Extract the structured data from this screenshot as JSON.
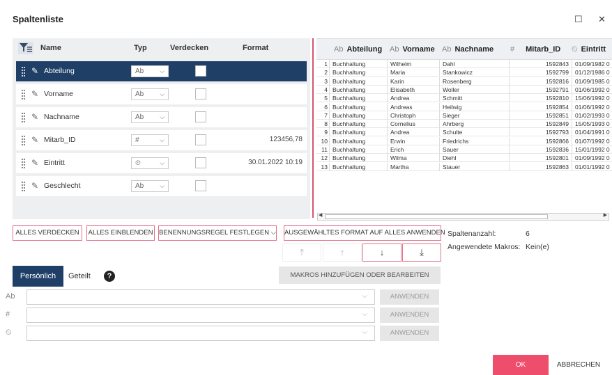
{
  "window": {
    "title": "Spaltenliste",
    "maximize": "☐",
    "close": "✕"
  },
  "columns_header": {
    "name": "Name",
    "typ": "Typ",
    "verdecken": "Verdecken",
    "format": "Format"
  },
  "column_rows": [
    {
      "name": "Abteilung",
      "typ": "Ab",
      "format": "",
      "selected": true
    },
    {
      "name": "Vorname",
      "typ": "Ab",
      "format": ""
    },
    {
      "name": "Nachname",
      "typ": "Ab",
      "format": ""
    },
    {
      "name": "Mitarb_ID",
      "typ": "#",
      "format": "123456,78"
    },
    {
      "name": "Eintritt",
      "typ": "⏲",
      "format": "30.01.2022 10:19"
    },
    {
      "name": "Geschlecht",
      "typ": "Ab",
      "format": ""
    }
  ],
  "data_header": {
    "abteilung": "Abteilung",
    "abteilung_icon": "Ab",
    "vorname": "Vorname",
    "vorname_icon": "Ab",
    "nachname": "Nachname",
    "nachname_icon": "Ab",
    "mitarb_id": "Mitarb_ID",
    "mitarb_icon": "#",
    "eintritt": "Eintritt",
    "eintritt_icon": "⏲"
  },
  "data_rows": [
    [
      "1",
      "Buchhaltung",
      "Wilhelm",
      "Dahl",
      "1592843",
      "01/09/1982 0"
    ],
    [
      "2",
      "Buchhaltung",
      "Maria",
      "Stankowicz",
      "1592799",
      "01/12/1986 0"
    ],
    [
      "3",
      "Buchhaltung",
      "Karin",
      "Rosenberg",
      "1592816",
      "01/09/1985 0"
    ],
    [
      "4",
      "Buchhaltung",
      "Elisabeth",
      "Woller",
      "1592791",
      "01/06/1992 0"
    ],
    [
      "5",
      "Buchhaltung",
      "Andrea",
      "Schmitt",
      "1592810",
      "15/06/1992 0"
    ],
    [
      "6",
      "Buchhaltung",
      "Andreas",
      "Heilwig",
      "1592854",
      "01/06/1992 0"
    ],
    [
      "7",
      "Buchhaltung",
      "Christoph",
      "Sieger",
      "1592851",
      "01/02/1993 0"
    ],
    [
      "8",
      "Buchhaltung",
      "Cornelius",
      "Ahrberg",
      "1592849",
      "15/05/1993 0"
    ],
    [
      "9",
      "Buchhaltung",
      "Andrea",
      "Schulte",
      "1592793",
      "01/04/1991 0"
    ],
    [
      "10",
      "Buchhaltung",
      "Erwin",
      "Friedrichs",
      "1592866",
      "01/07/1992 0"
    ],
    [
      "11",
      "Buchhaltung",
      "Erich",
      "Sauer",
      "1592836",
      "15/01/1992 0"
    ],
    [
      "12",
      "Buchhaltung",
      "Wilma",
      "Diehl",
      "1592801",
      "01/09/1992 0"
    ],
    [
      "13",
      "Buchhaltung",
      "Martha",
      "Stauer",
      "1592863",
      "01/01/1992 0"
    ]
  ],
  "buttons": {
    "hide_all": "ALLES VERDECKEN",
    "show_all": "ALLES EINBLENDEN",
    "naming_rule": "BENENNUNGSREGEL FESTLEGEN ⌵",
    "apply_format": "AUSGEWÄHLTES FORMAT AUF ALLES ANWENDEN",
    "macros": "MAKROS HINZUFÜGEN ODER BEARBEITEN",
    "apply": "ANWENDEN",
    "ok": "OK",
    "cancel": "ABBRECHEN"
  },
  "info": {
    "count_label": "Spaltenanzahl:",
    "count_value": "6",
    "macros_label": "Angewendete Makros:",
    "macros_value": "Kein(e)"
  },
  "tabs": {
    "personal": "Persönlich",
    "shared": "Geteilt",
    "help": "?"
  },
  "format_rows": [
    {
      "label": "Ab"
    },
    {
      "label": "#"
    },
    {
      "label": "⏲"
    }
  ]
}
